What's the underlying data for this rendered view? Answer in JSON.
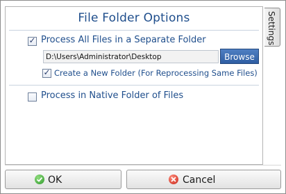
{
  "header": {
    "title": "File Folder Options"
  },
  "options": {
    "separate_folder": {
      "label": "Process All Files in a Separate Folder",
      "checked": true
    },
    "folder_path": {
      "value": "D:\\Users\\Administrator\\Desktop"
    },
    "browse_label": "Browse",
    "create_new_folder": {
      "label": "Create a New Folder (For Reprocessing Same Files)",
      "checked": true
    },
    "native_folder": {
      "label": "Process in Native Folder of Files",
      "checked": false
    }
  },
  "side_tab": {
    "label": "Settings"
  },
  "footer": {
    "ok_label": "OK",
    "cancel_label": "Cancel"
  },
  "icons": {
    "ok": "check-circle-icon",
    "cancel": "cancel-circle-icon"
  },
  "colors": {
    "accent": "#1f4e8c",
    "browse_button": "#3a67ab",
    "ok_green": "#2f9a2c",
    "cancel_red": "#c7261a"
  }
}
